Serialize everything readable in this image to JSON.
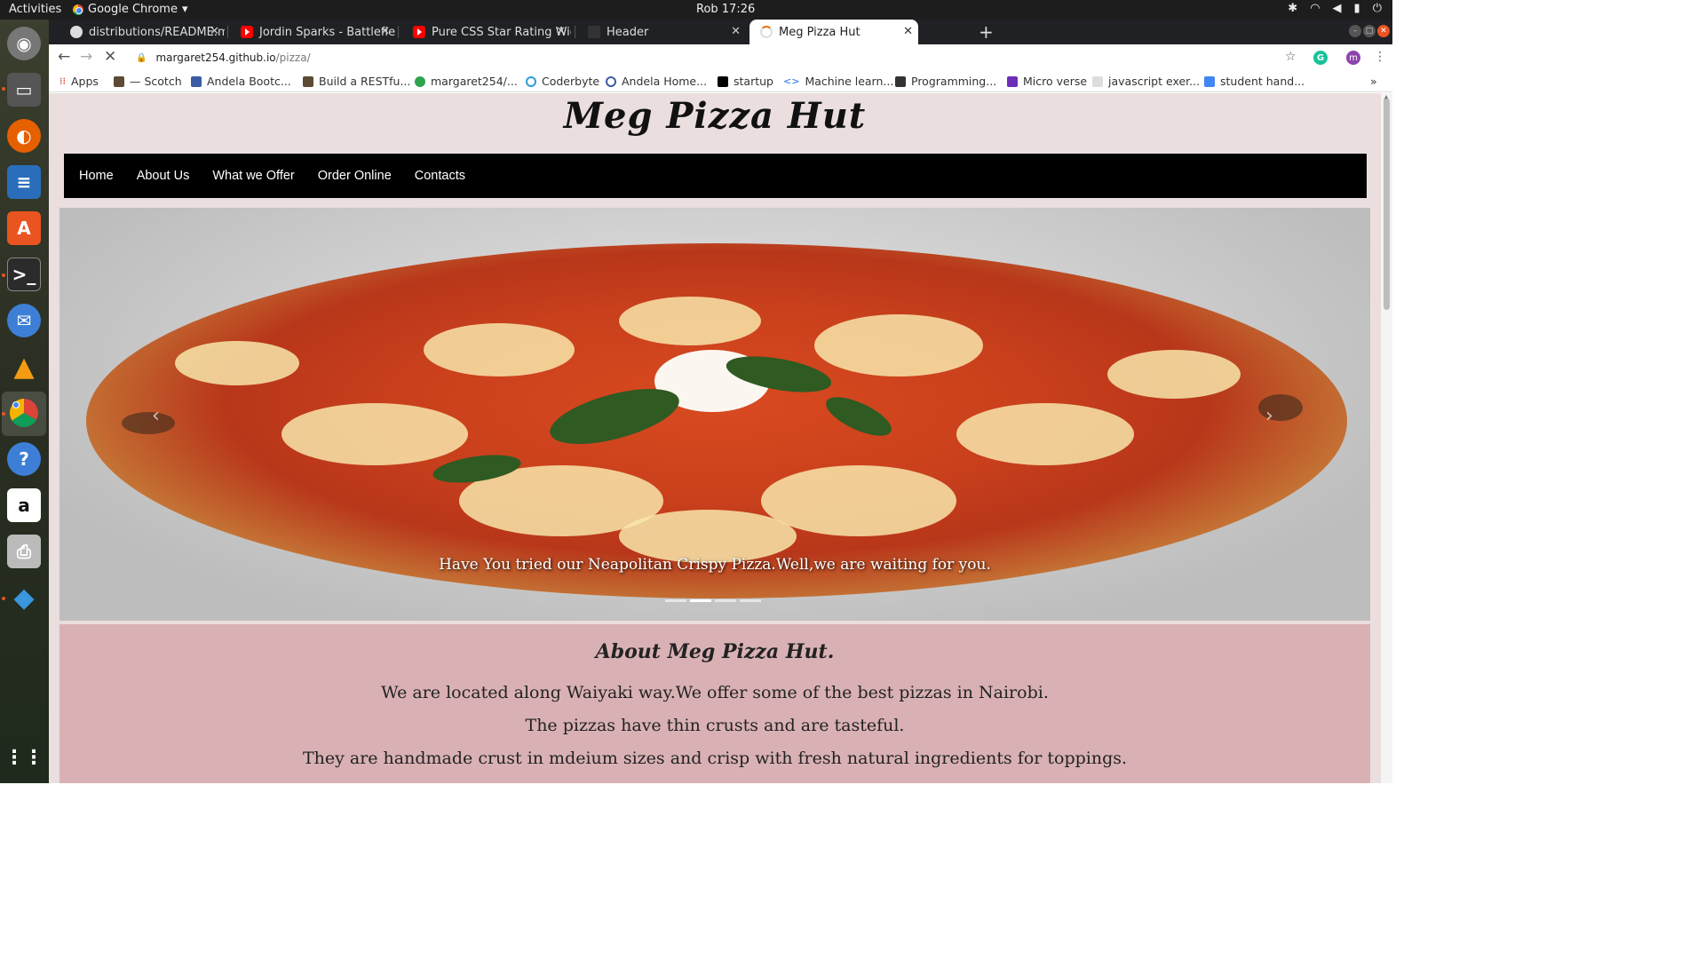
{
  "system": {
    "activities": "Activities",
    "app_menu": "Google Chrome",
    "clock": "Rob 17:26"
  },
  "tabs": [
    {
      "title": "distributions/README.m",
      "icon": "github-icon"
    },
    {
      "title": "Jordin Sparks - Battlefield",
      "icon": "youtube-icon"
    },
    {
      "title": "Pure CSS Star Rating Widg",
      "icon": "youtube-icon"
    },
    {
      "title": "Header",
      "icon": "page-icon"
    },
    {
      "title": "Meg Pizza Hut",
      "icon": "loading-icon",
      "active": true
    }
  ],
  "address": {
    "host": "margaret254.github.io",
    "path": "/pizza/"
  },
  "bookmarks": [
    "Apps",
    "— Scotch",
    "Andela Bootc...",
    "Build a RESTfu...",
    "margaret254/...",
    "Coderbyte",
    "Andela Home...",
    "startup",
    "Machine learn...",
    "Programming...",
    "Micro verse",
    "javascript exer...",
    "student hand..."
  ],
  "site": {
    "title": "Meg Pizza Hut",
    "nav": [
      "Home",
      "About Us",
      "What we Offer",
      "Order Online",
      "Contacts"
    ],
    "carousel_caption": "Have You tried our Neapolitan Crispy Pizza.Well,we are waiting for you.",
    "carousel_active_index": 1,
    "carousel_slide_count": 4,
    "about_heading": "About Meg Pizza Hut.",
    "about_lines": [
      "We are located along Waiyaki way.We offer some of the best pizzas in Nairobi.",
      "The pizzas have thin crusts and are tasteful.",
      "They are handmade crust in mdeium sizes and crisp with fresh natural ingredients for toppings."
    ]
  },
  "colors": {
    "page_bg": "#eadede",
    "navbar_bg": "#000000",
    "about_bg": "#d9b1b4"
  }
}
